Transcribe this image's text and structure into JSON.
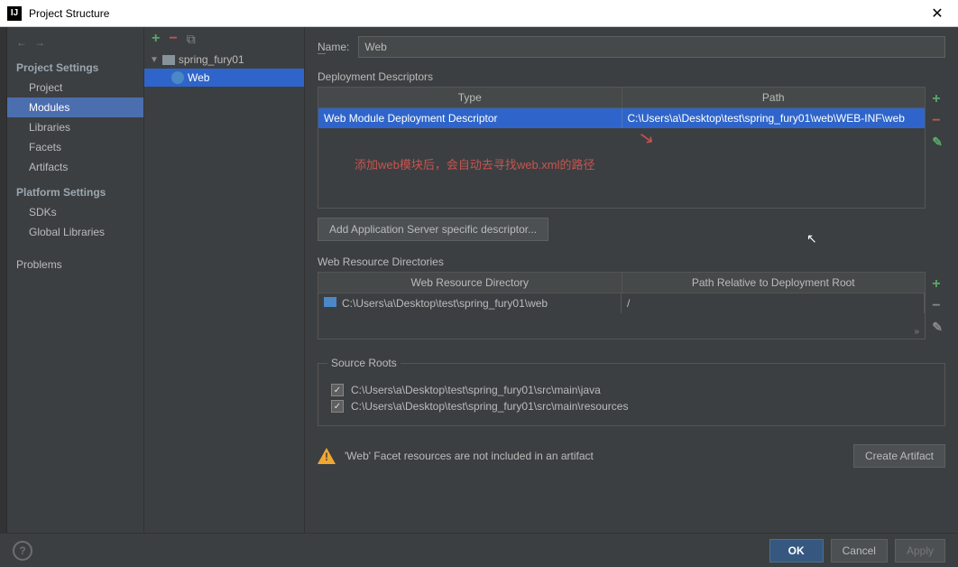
{
  "window": {
    "title": "Project Structure"
  },
  "sidebar": {
    "project_settings": "Project Settings",
    "items": [
      "Project",
      "Modules",
      "Libraries",
      "Facets",
      "Artifacts"
    ],
    "platform_settings": "Platform Settings",
    "platform_items": [
      "SDKs",
      "Global Libraries"
    ],
    "problems": "Problems"
  },
  "tree": {
    "root": "spring_fury01",
    "child": "Web"
  },
  "name": {
    "label": "Name:",
    "value": "Web"
  },
  "dep": {
    "title": "Deployment Descriptors",
    "th1": "Type",
    "th2": "Path",
    "row_type": "Web Module Deployment Descriptor",
    "row_path": "C:\\Users\\a\\Desktop\\test\\spring_fury01\\web\\WEB-INF\\web",
    "annotation": "添加web模块后，会自动去寻找web.xml的路径",
    "add_btn": "Add Application Server specific descriptor..."
  },
  "res": {
    "title": "Web Resource Directories",
    "th1": "Web Resource Directory",
    "th2": "Path Relative to Deployment Root",
    "dir": "C:\\Users\\a\\Desktop\\test\\spring_fury01\\web",
    "path": "/"
  },
  "src": {
    "title": "Source Roots",
    "root1": "C:\\Users\\a\\Desktop\\test\\spring_fury01\\src\\main\\java",
    "root2": "C:\\Users\\a\\Desktop\\test\\spring_fury01\\src\\main\\resources"
  },
  "warning": {
    "text": "'Web' Facet resources are not included in an artifact",
    "btn": "Create Artifact"
  },
  "footer": {
    "ok": "OK",
    "cancel": "Cancel",
    "apply": "Apply"
  }
}
